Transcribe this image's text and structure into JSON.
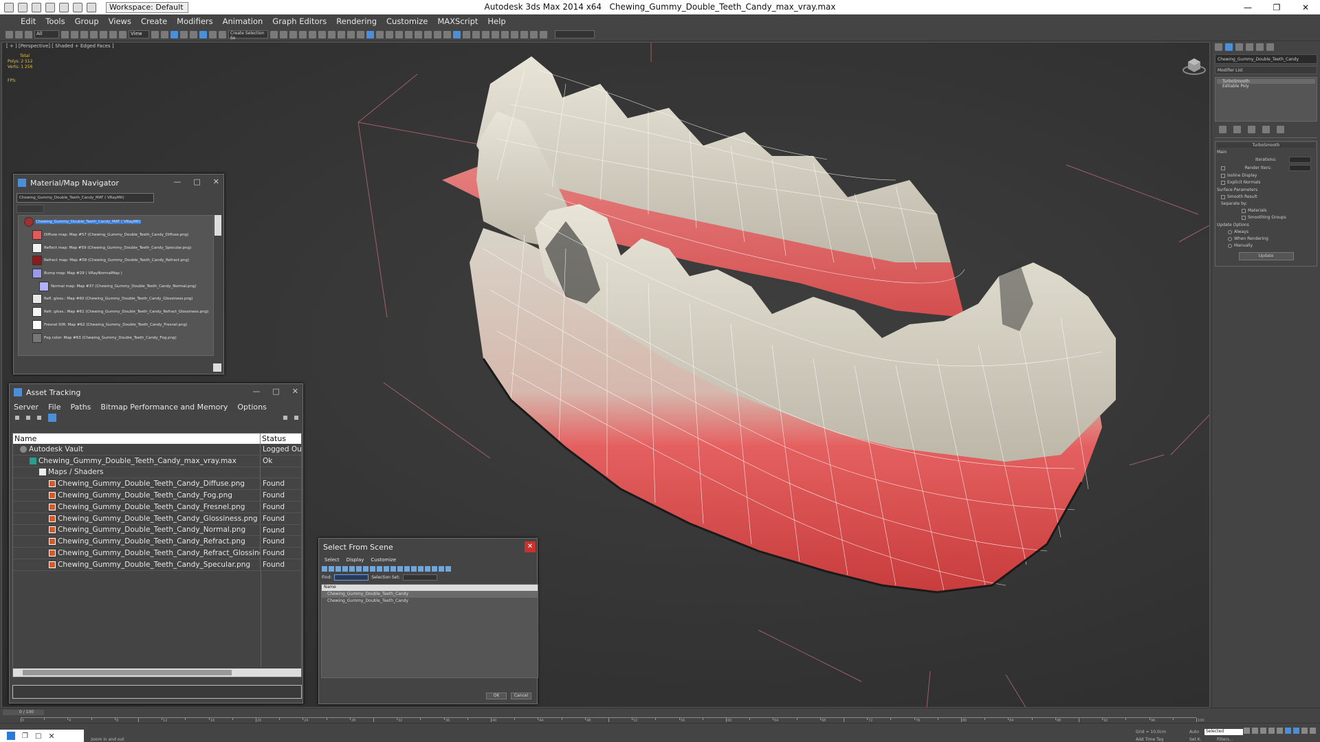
{
  "titlebar": {
    "app_title": "Autodesk 3ds Max  2014 x64",
    "file_title": "Chewing_Gummy_Double_Teeth_Candy_max_vray.max",
    "workspace": "Workspace: Default"
  },
  "menu": [
    "Edit",
    "Tools",
    "Group",
    "Views",
    "Create",
    "Modifiers",
    "Animation",
    "Graph Editors",
    "Rendering",
    "Customize",
    "MAXScript",
    "Help"
  ],
  "toolbar": {
    "selection_filter": "All",
    "view": "View",
    "named_sel": "Create Selection Se"
  },
  "viewport": {
    "label": "[ + ] [Perspective] [ Shaded + Edged Faces ]",
    "stats_total": "Total",
    "stats_polys": "Polys:  2 512",
    "stats_verts": "Verts:  1 256",
    "fps": "FPS:"
  },
  "cmd_panel": {
    "object_name": "Chewing_Gummy_Double_Teeth_Candy",
    "modifier_list": "Modifier List",
    "stack": [
      "TurboSmooth",
      "Editable Poly"
    ],
    "turbosmooth": "TurboSmooth",
    "main": "Main",
    "iterations": "Iterations:",
    "render_iters": "Render Iters:",
    "isoline": "Isoline Display",
    "explicit": "Explicit Normals",
    "surface": "Surface Parameters",
    "smooth_result": "Smooth Result",
    "separate_by": "Separate by:",
    "materials": "Materials",
    "smoothing_groups": "Smoothing Groups",
    "update_options": "Update Options",
    "always": "Always",
    "when_rendering": "When Rendering",
    "manually": "Manually",
    "update_btn": "Update"
  },
  "mat_nav": {
    "title": "Material/Map Navigator",
    "search": "Chewing_Gummy_Double_Teeth_Candy_MAT  ( VRayMtl)",
    "items": [
      {
        "label": "Chewing_Gummy_Double_Teeth_Candy_MAT  ( VRayMtl)",
        "color": "#a03030"
      },
      {
        "label": "Diffuse map: Map #57 (Chewing_Gummy_Double_Teeth_Candy_Diffuse.png)",
        "color": "#e45a5a"
      },
      {
        "label": "Reflect map: Map #59 (Chewing_Gummy_Double_Teeth_Candy_Specular.png)",
        "color": "#f2f2f2"
      },
      {
        "label": "Refract map: Map #58 (Chewing_Gummy_Double_Teeth_Candy_Refract.png)",
        "color": "#8b1a1a"
      },
      {
        "label": "Bump map: Map #29  ( VRayNormalMap )",
        "color": "#9a9ae6"
      },
      {
        "label": "Normal map: Map #37 (Chewing_Gummy_Double_Teeth_Candy_Normal.png)",
        "color": "#b0b0ff"
      },
      {
        "label": "Refl. gloss.: Map #60 (Chewing_Gummy_Double_Teeth_Candy_Glossiness.png)",
        "color": "#e8e8e8"
      },
      {
        "label": "Refr. gloss.: Map #61 (Chewing_Gummy_Double_Teeth_Candy_Refract_Glossiness.png)",
        "color": "#f5f5f5"
      },
      {
        "label": "Fresnel IOR: Map #62 (Chewing_Gummy_Double_Teeth_Candy_Fresnel.png)",
        "color": "#fafafa"
      },
      {
        "label": "Fog color: Map #63 (Chewing_Gummy_Double_Teeth_Candy_Fog.png)",
        "color": "#777777"
      }
    ]
  },
  "asset": {
    "title": "Asset Tracking",
    "menu": [
      "Server",
      "File",
      "Paths",
      "Bitmap Performance and Memory",
      "Options"
    ],
    "col_name": "Name",
    "col_status": "Status",
    "rows": [
      {
        "name": "Autodesk Vault",
        "status": "Logged Out (",
        "icon": "vault",
        "indent": 0
      },
      {
        "name": "Chewing_Gummy_Double_Teeth_Candy_max_vray.max",
        "status": "Ok",
        "icon": "max",
        "indent": 1
      },
      {
        "name": "Maps / Shaders",
        "status": "",
        "icon": "fold",
        "indent": 2
      },
      {
        "name": "Chewing_Gummy_Double_Teeth_Candy_Diffuse.png",
        "status": "Found",
        "icon": "png",
        "indent": 3
      },
      {
        "name": "Chewing_Gummy_Double_Teeth_Candy_Fog.png",
        "status": "Found",
        "icon": "png",
        "indent": 3
      },
      {
        "name": "Chewing_Gummy_Double_Teeth_Candy_Fresnel.png",
        "status": "Found",
        "icon": "png",
        "indent": 3
      },
      {
        "name": "Chewing_Gummy_Double_Teeth_Candy_Glossiness.png",
        "status": "Found",
        "icon": "png",
        "indent": 3
      },
      {
        "name": "Chewing_Gummy_Double_Teeth_Candy_Normal.png",
        "status": "Found",
        "icon": "png",
        "indent": 3
      },
      {
        "name": "Chewing_Gummy_Double_Teeth_Candy_Refract.png",
        "status": "Found",
        "icon": "png",
        "indent": 3
      },
      {
        "name": "Chewing_Gummy_Double_Teeth_Candy_Refract_Glossiness.png",
        "status": "Found",
        "icon": "png",
        "indent": 3
      },
      {
        "name": "Chewing_Gummy_Double_Teeth_Candy_Specular.png",
        "status": "Found",
        "icon": "png",
        "indent": 3
      }
    ]
  },
  "sfs": {
    "title": "Select From Scene",
    "menu": [
      "Select",
      "Display",
      "Customize"
    ],
    "find": "Find:",
    "selection_set": "Selection Set:",
    "col_name": "Name",
    "rows": [
      "Chewing_Gummy_Double_Teeth_Candy",
      "Chewing_Gummy_Double_Teeth_Candy"
    ],
    "ok": "OK",
    "cancel": "Cancel"
  },
  "timeline": {
    "frame": "0 / 100"
  },
  "status": {
    "prompt": "zoom in and out",
    "selected": "Selected",
    "grid": "Grid = 10,0cm",
    "auto": "Auto",
    "set_k": "Set K.",
    "filters": "Filters...",
    "add_time_tag": "Add Time Tag"
  }
}
